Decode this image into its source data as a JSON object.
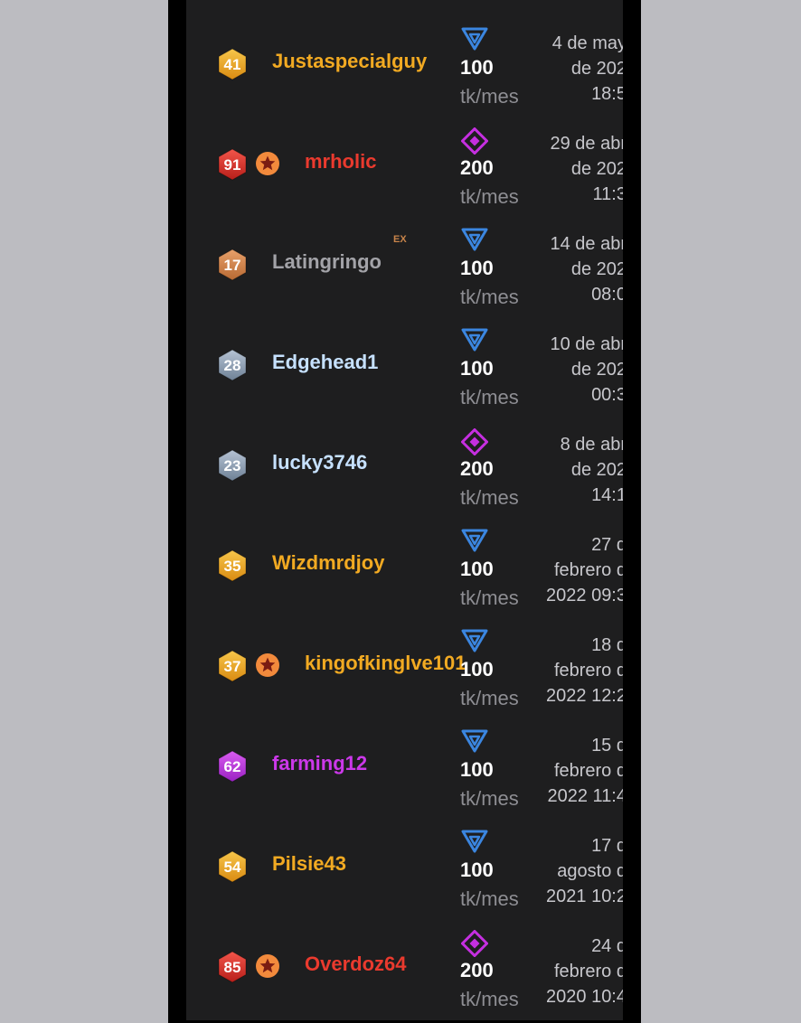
{
  "colors": {
    "gold": "#f2aa22",
    "red": "#ea3a2e",
    "gray": "#a3a3a8",
    "silver": "#c6e1ff",
    "purple": "#cc38ea",
    "blue_tier": "#3b86e0",
    "purple_tier": "#c52fe0",
    "star_badge": "#f28a3c"
  },
  "subscribers": [
    {
      "level": "41",
      "level_color": "gold",
      "star": false,
      "ex": false,
      "name": "Justaspecialguy",
      "name_color": "gold",
      "tier": "triangle",
      "amount": "100",
      "unit": "tk/mes",
      "date": [
        "4 de may",
        "de 202",
        "18:5"
      ]
    },
    {
      "level": "91",
      "level_color": "red",
      "star": true,
      "ex": false,
      "name": "mrholic",
      "name_color": "red",
      "tier": "diamond",
      "amount": "200",
      "unit": "tk/mes",
      "date": [
        "29 de abr",
        "de 202",
        "11:3"
      ]
    },
    {
      "level": "17",
      "level_color": "bronze",
      "star": false,
      "ex": true,
      "ex_label": "EX",
      "name": "Latingringo",
      "name_color": "gray",
      "tier": "triangle",
      "amount": "100",
      "unit": "tk/mes",
      "date": [
        "14 de abr",
        "de 202",
        "08:0"
      ]
    },
    {
      "level": "28",
      "level_color": "silver",
      "star": false,
      "ex": false,
      "name": "Edgehead1",
      "name_color": "silver",
      "tier": "triangle",
      "amount": "100",
      "unit": "tk/mes",
      "date": [
        "10 de abr",
        "de 202",
        "00:3"
      ]
    },
    {
      "level": "23",
      "level_color": "silver",
      "star": false,
      "ex": false,
      "name": "lucky3746",
      "name_color": "silver",
      "tier": "diamond",
      "amount": "200",
      "unit": "tk/mes",
      "date": [
        "8 de abr",
        "de 202",
        "14:1"
      ]
    },
    {
      "level": "35",
      "level_color": "gold",
      "star": false,
      "ex": false,
      "name": "Wizdmrdjoy",
      "name_color": "gold",
      "tier": "triangle",
      "amount": "100",
      "unit": "tk/mes",
      "date": [
        "27 d",
        "febrero d",
        "2022 09:3"
      ]
    },
    {
      "level": "37",
      "level_color": "gold",
      "star": true,
      "ex": false,
      "name": "kingofkinglve101",
      "name_color": "gold",
      "tier": "triangle",
      "amount": "100",
      "unit": "tk/mes",
      "date": [
        "18 d",
        "febrero d",
        "2022 12:2"
      ]
    },
    {
      "level": "62",
      "level_color": "purple",
      "star": false,
      "ex": false,
      "name": "farming12",
      "name_color": "purple",
      "tier": "triangle",
      "amount": "100",
      "unit": "tk/mes",
      "date": [
        "15 d",
        "febrero d",
        "2022 11:4"
      ]
    },
    {
      "level": "54",
      "level_color": "gold",
      "star": false,
      "ex": false,
      "name": "Pilsie43",
      "name_color": "gold",
      "tier": "triangle",
      "amount": "100",
      "unit": "tk/mes",
      "date": [
        "17 d",
        "agosto d",
        "2021 10:2"
      ]
    },
    {
      "level": "85",
      "level_color": "red",
      "star": true,
      "ex": false,
      "name": "Overdoz64",
      "name_color": "red",
      "tier": "diamond",
      "amount": "200",
      "unit": "tk/mes",
      "date": [
        "24 d",
        "febrero d",
        "2020 10:4"
      ]
    }
  ]
}
